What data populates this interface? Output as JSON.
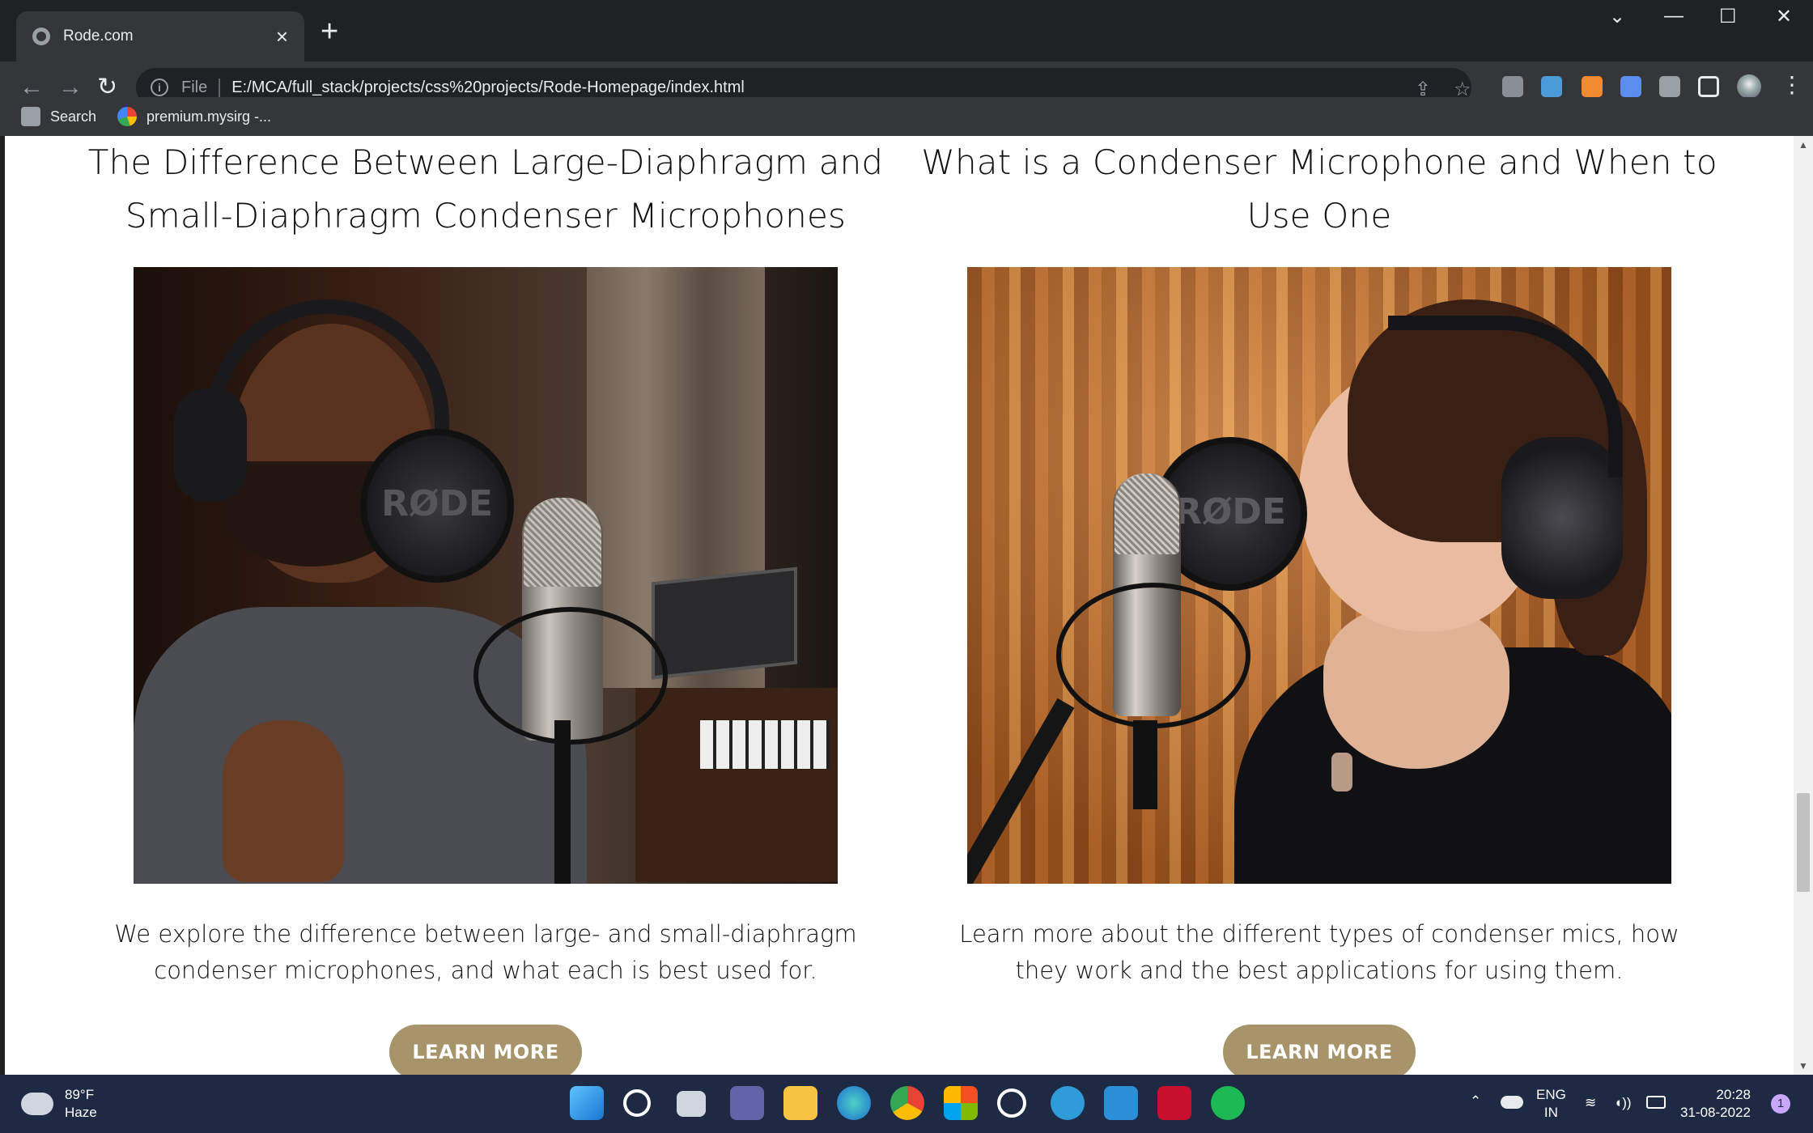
{
  "browser": {
    "tab_title": "Rode.com",
    "tab_close": "×",
    "new_tab": "+",
    "scheme_label": "File",
    "url": "E:/MCA/full_stack/projects/css%20projects/Rode-Homepage/index.html",
    "bookmarks": [
      {
        "label": "Search",
        "icon": "search-icon"
      },
      {
        "label": "premium.mysirg -...",
        "icon": "google-icon"
      }
    ],
    "window_controls": {
      "tab_search": "⌄",
      "minimize": "—",
      "maximize": "☐",
      "close": "✕"
    }
  },
  "articles": [
    {
      "title": "The Difference Between Large-Diaphragm and Small-Diaphragm Condenser Microphones",
      "photo_logo": "RØDE",
      "description": "We explore the difference between large- and small-diaphragm condenser microphones, and what each is best used for.",
      "button": "LEARN MORE"
    },
    {
      "title": "What is a Condenser Microphone and When to Use One",
      "photo_logo": "RØDE",
      "description": "Learn more about the different types of condenser mics, how they work and the best applications for using them.",
      "button": "LEARN MORE"
    }
  ],
  "colors": {
    "button_bg": "#a8946a",
    "button_text": "#ffffff",
    "page_bg": "#ffffff",
    "chrome_dark": "#202124",
    "chrome_toolbar": "#35363a",
    "taskbar": "#1e2a44"
  },
  "taskbar": {
    "weather_temp": "89°F",
    "weather_desc": "Haze",
    "lang_line1": "ENG",
    "lang_line2": "IN",
    "time": "20:28",
    "date": "31-08-2022",
    "notification_count": "1",
    "apps": [
      "windows-start",
      "search",
      "task-view",
      "teams",
      "file-explorer",
      "edge",
      "chrome",
      "microsoft-store",
      "app",
      "help",
      "vscode",
      "mcafee",
      "spotify"
    ]
  }
}
